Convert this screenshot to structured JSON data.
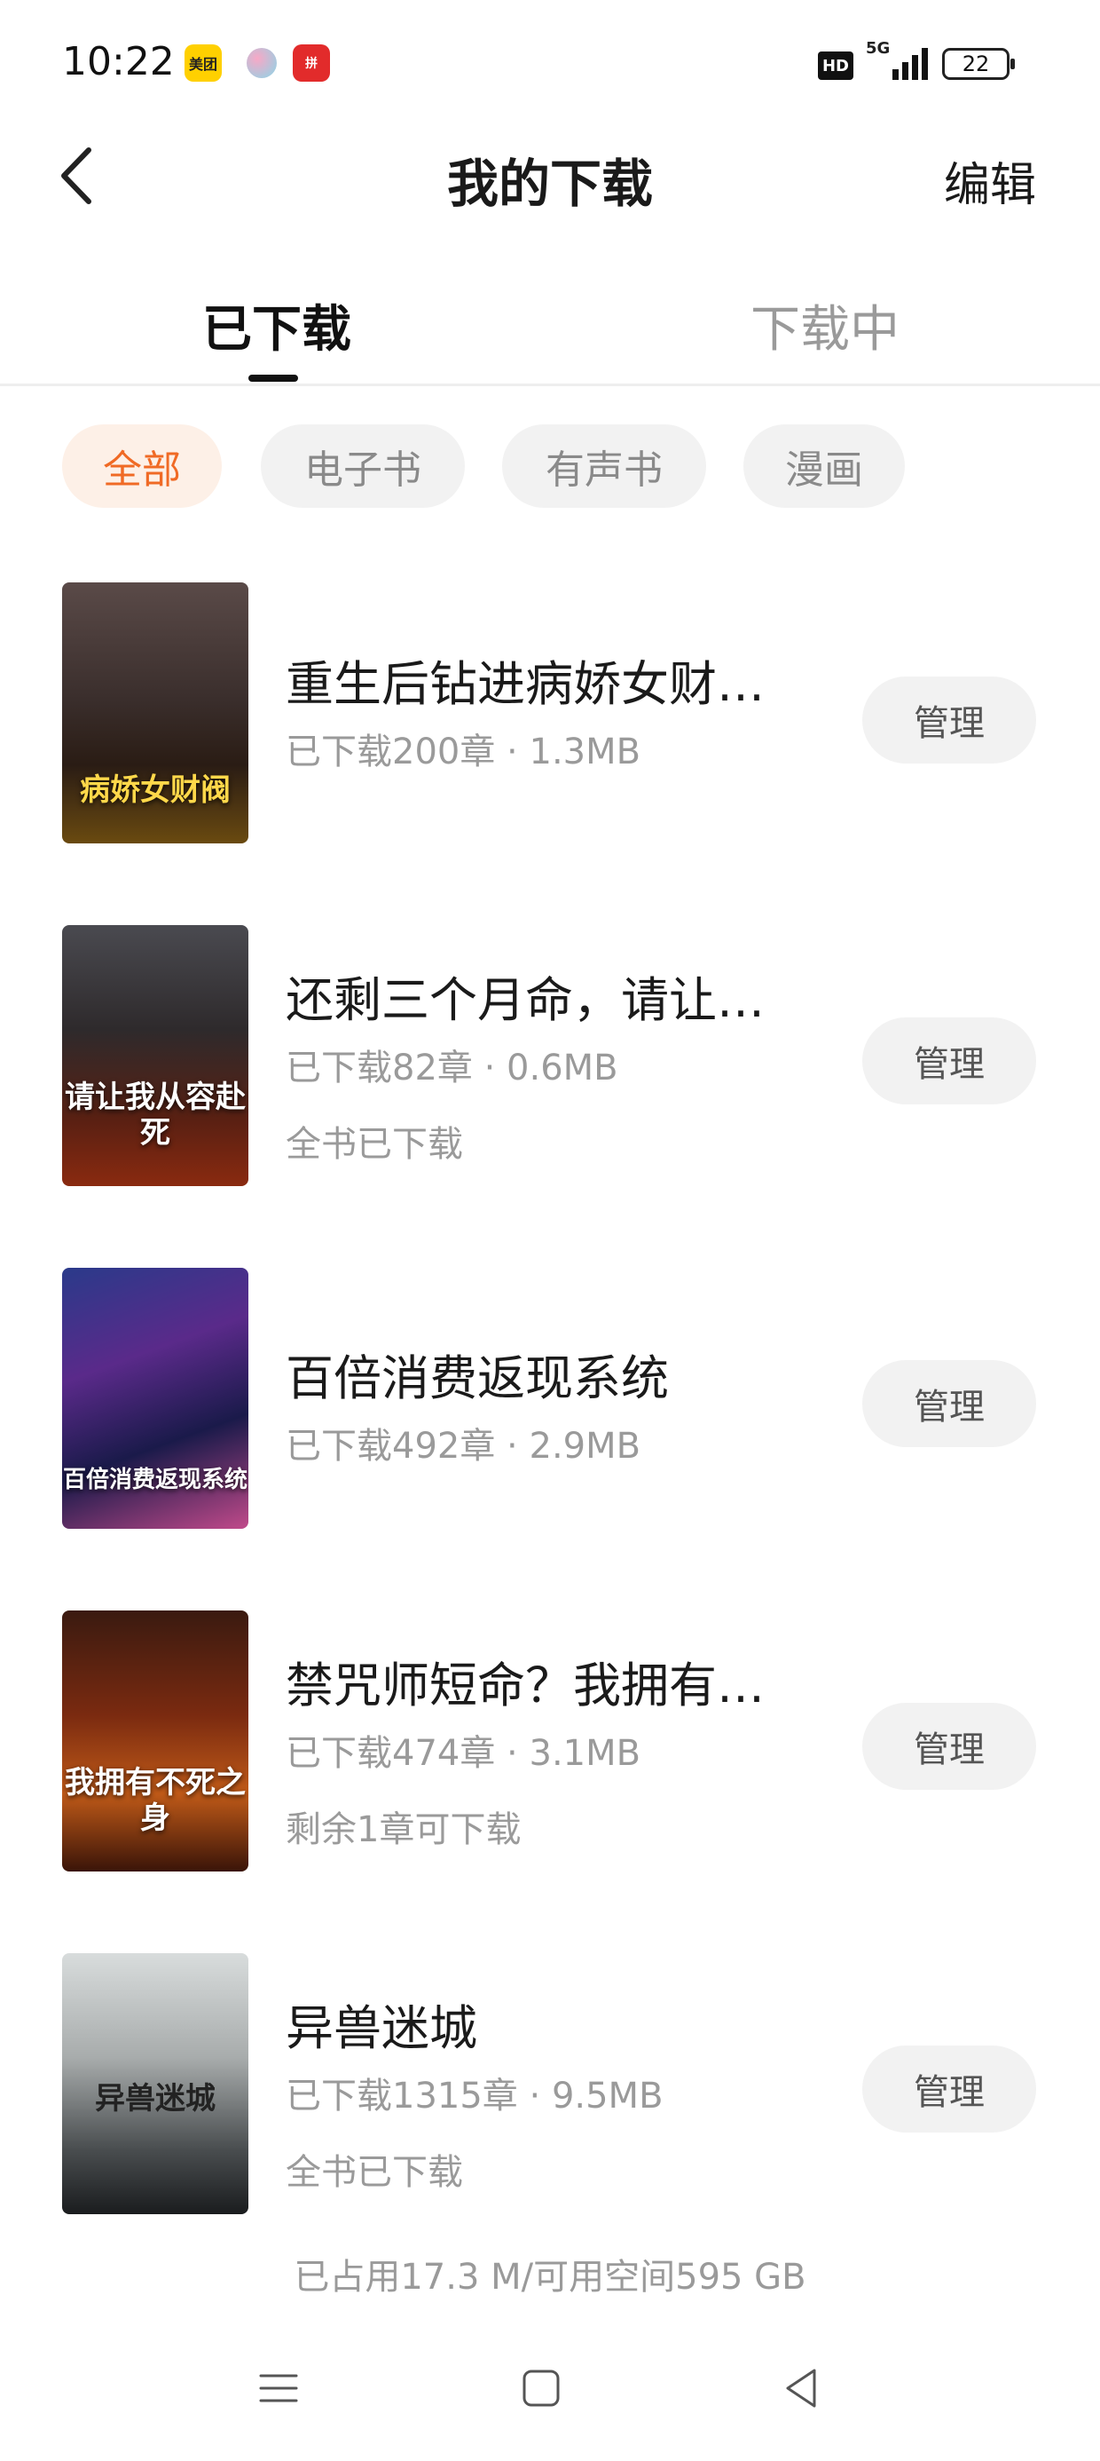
{
  "status_bar": {
    "time": "10:22",
    "app_badges": [
      "美团",
      "",
      "拼多多"
    ],
    "hd": "HD",
    "network": "5G",
    "battery": "22"
  },
  "header": {
    "title": "我的下载",
    "edit_label": "编辑"
  },
  "tabs": [
    {
      "label": "已下载",
      "active": true
    },
    {
      "label": "下载中",
      "active": false
    }
  ],
  "filters": [
    {
      "label": "全部",
      "active": true
    },
    {
      "label": "电子书",
      "active": false
    },
    {
      "label": "有声书",
      "active": false
    },
    {
      "label": "漫画",
      "active": false
    }
  ],
  "books": [
    {
      "title": "重生后钻进病娇女财…",
      "meta": "已下载200章 · 1.3MB",
      "note": "",
      "manage_label": "管理",
      "cover_text": "病娇女财阀"
    },
    {
      "title": "还剩三个月命，请让…",
      "meta": "已下载82章 · 0.6MB",
      "note": "全书已下载",
      "manage_label": "管理",
      "cover_text": "请让我从容赴死"
    },
    {
      "title": "百倍消费返现系统",
      "meta": "已下载492章 · 2.9MB",
      "note": "",
      "manage_label": "管理",
      "cover_text": "百倍消费返现系统"
    },
    {
      "title": "禁咒师短命？我拥有…",
      "meta": "已下载474章 · 3.1MB",
      "note": "剩余1章可下载",
      "manage_label": "管理",
      "cover_text": "我拥有不死之身"
    },
    {
      "title": "异兽迷城",
      "meta": "已下载1315章 · 9.5MB",
      "note": "全书已下载",
      "manage_label": "管理",
      "cover_text": "异兽迷城"
    }
  ],
  "storage": "已占用17.3 M/可用空间595 GB",
  "colors": {
    "accent": "#f06a25",
    "chip_bg": "#f2f2f2",
    "muted_text": "#9a9a9a"
  }
}
